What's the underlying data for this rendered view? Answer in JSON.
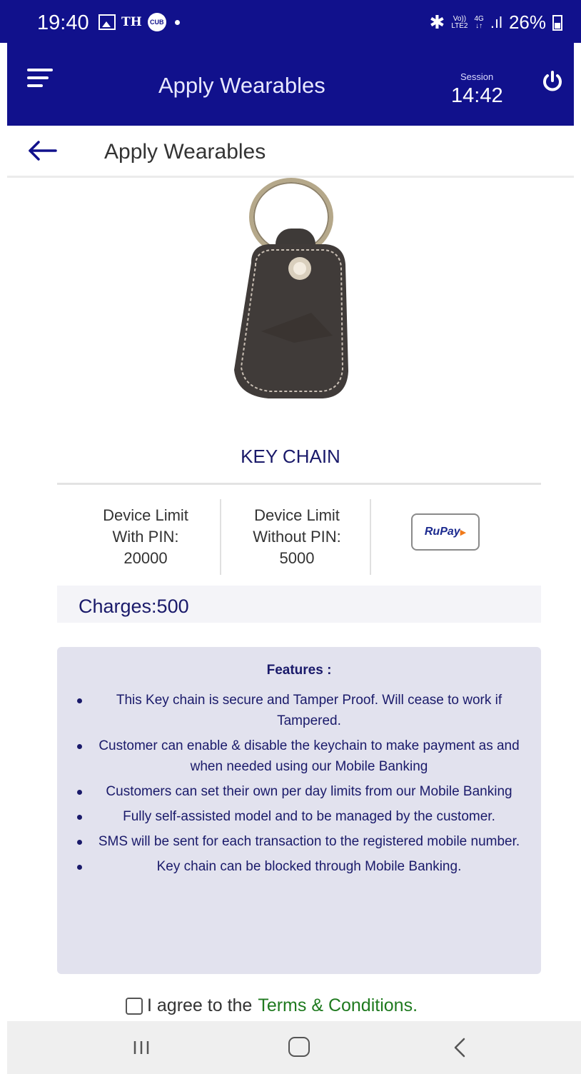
{
  "status_bar": {
    "time": "19:40",
    "carrier_text": "TH",
    "app_badge": "CUB",
    "network_top": "Vo))",
    "network_bottom": "LTE2",
    "data_top": "4G",
    "data_bottom": "↓↑",
    "battery": "26%"
  },
  "app_bar": {
    "title": "Apply Wearables",
    "session_label": "Session",
    "session_time": "14:42"
  },
  "sub_header": {
    "title": "Apply Wearables"
  },
  "product": {
    "name": "KEY CHAIN",
    "limit_with_pin_line1": "Device Limit",
    "limit_with_pin_line2": "With PIN:",
    "limit_with_pin_value": "20000",
    "limit_without_pin_line1": "Device Limit",
    "limit_without_pin_line2": "Without PIN:",
    "limit_without_pin_value": "5000",
    "card_network": "RuPay",
    "charges": "Charges:500"
  },
  "features": {
    "title": "Features :",
    "items": [
      "This Key chain is secure and Tamper Proof. Will cease to work if Tampered.",
      "Customer can enable & disable the keychain to make payment as and when needed using our Mobile Banking",
      "Customers can set their own per day limits from our Mobile Banking",
      "Fully self-assisted model and to be managed by the customer.",
      "SMS will be sent for each transaction to the registered mobile number.",
      "Key chain can be blocked through Mobile Banking."
    ]
  },
  "agreement": {
    "text": "I agree to the",
    "link": "Terms & Conditions."
  },
  "colors": {
    "primary": "#11118c",
    "link": "#1f7a1f",
    "features_bg": "#e2e2ee"
  }
}
